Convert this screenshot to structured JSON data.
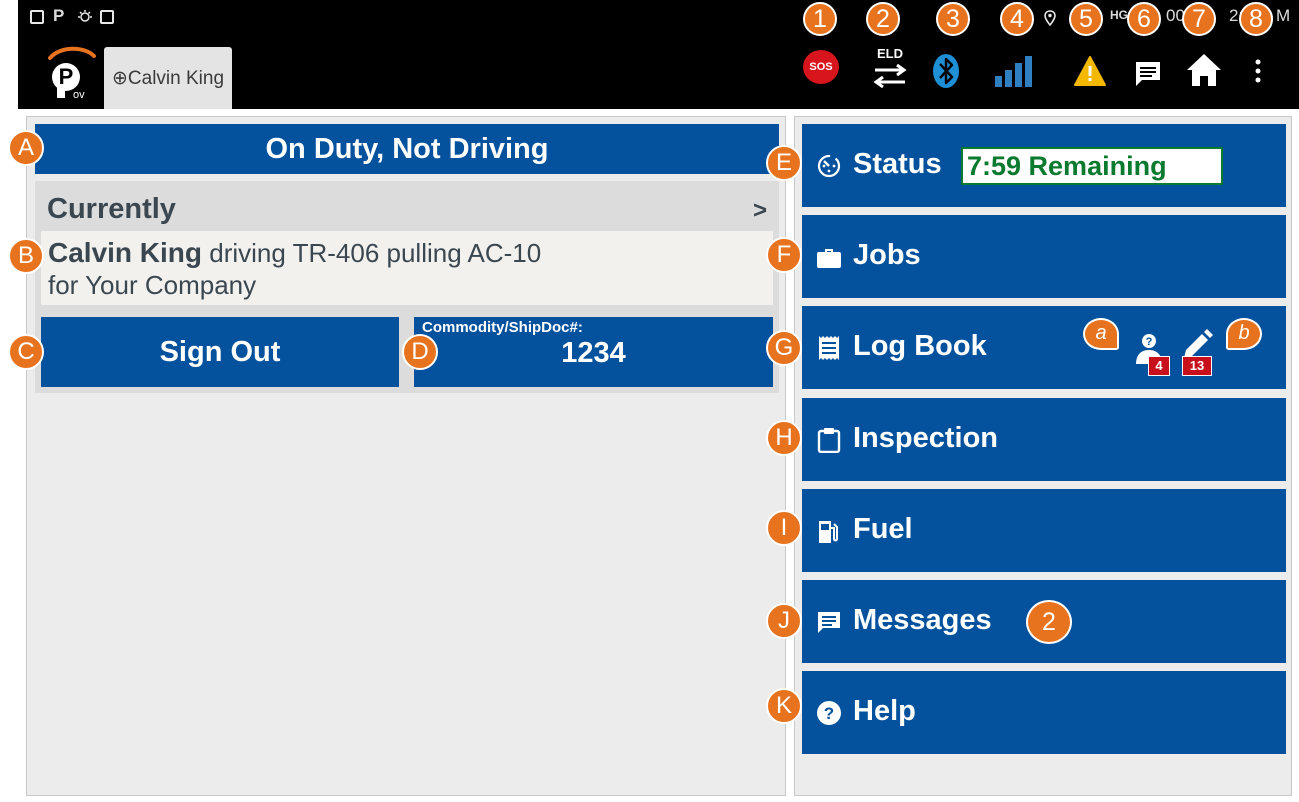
{
  "status_bar": {
    "left_glyph": "P",
    "right_text_partial_1": "HG",
    "right_text_partial_2": "00",
    "right_text_partial_3": "2:",
    "right_text_partial_4": "M"
  },
  "header": {
    "tab_label": "⊕Calvin King",
    "sos_label": "SOS",
    "eld_label": "ELD",
    "callouts": [
      "1",
      "2",
      "3",
      "4",
      "5",
      "6",
      "7",
      "8"
    ]
  },
  "duty_status": "On Duty, Not Driving",
  "currently": {
    "label": "Currently",
    "arrow": ">",
    "driver_name": "Calvin King",
    "driver_detail": "driving TR-406 pulling AC-10",
    "company_line": "for Your Company"
  },
  "sign_out_label": "Sign Out",
  "commodity": {
    "label": "Commodity/ShipDoc#:",
    "value": "1234"
  },
  "menu": {
    "status": {
      "label": "Status",
      "remaining": "7:59 Remaining"
    },
    "jobs": {
      "label": "Jobs"
    },
    "logbook": {
      "label": "Log Book",
      "unassigned_count": "4",
      "edits_count": "13"
    },
    "inspection": {
      "label": "Inspection"
    },
    "fuel": {
      "label": "Fuel"
    },
    "messages": {
      "label": "Messages",
      "count": "2"
    },
    "help": {
      "label": "Help"
    }
  },
  "callouts": {
    "A": "A",
    "B": "B",
    "C": "C",
    "D": "D",
    "E": "E",
    "F": "F",
    "G": "G",
    "H": "H",
    "I": "I",
    "J": "J",
    "K": "K",
    "a": "a",
    "b": "b"
  },
  "colors": {
    "primary_blue": "#04519d",
    "callout_orange": "#e8731f",
    "remaining_green": "#0a7a2e",
    "sos_red": "#d8141c",
    "warning_yellow": "#f5b800",
    "bluetooth_blue": "#1e8fd4",
    "signal_blue": "#2f7fc1"
  },
  "icons": {
    "sos": "sos-icon",
    "eld": "eld-transfer-icon",
    "bluetooth": "bluetooth-icon",
    "signal": "signal-bars-icon",
    "warning": "warning-icon",
    "messages": "chat-icon",
    "home": "home-icon",
    "overflow": "kebab-menu-icon",
    "status": "timer-icon",
    "jobs": "briefcase-icon",
    "logbook": "receipt-icon",
    "inspection": "clipboard-icon",
    "fuel": "fuel-pump-icon",
    "help": "help-circle-icon"
  }
}
